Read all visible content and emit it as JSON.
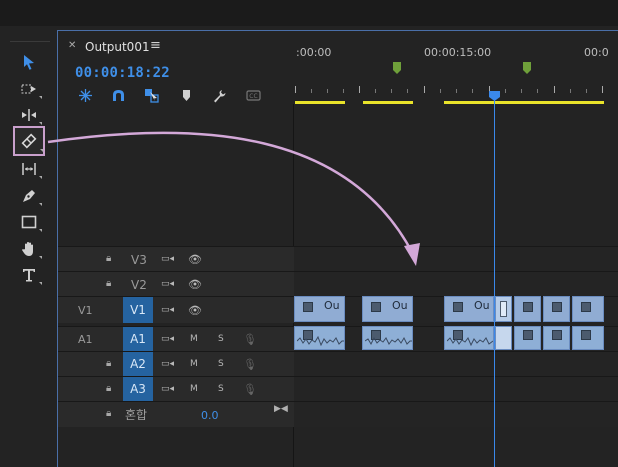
{
  "timeline": {
    "sequence_name": "Output001",
    "timecode": "00:00:18:22",
    "ruler_labels": [
      ":00:00",
      "00:00:15:00",
      "00:0"
    ]
  },
  "tracks": {
    "v3": {
      "name": "V3"
    },
    "v2": {
      "name": "V2"
    },
    "v1": {
      "source": "V1",
      "name": "V1"
    },
    "a1": {
      "source": "A1",
      "name": "A1",
      "mute": "M",
      "solo": "S"
    },
    "a2": {
      "name": "A2",
      "mute": "M",
      "solo": "S"
    },
    "a3": {
      "name": "A3",
      "mute": "M",
      "solo": "S"
    },
    "mix": {
      "name": "혼합",
      "value": "0.0"
    }
  },
  "clips": {
    "label": "Ou"
  },
  "tools": [
    "selection-tool",
    "track-select-tool",
    "ripple-edit-tool",
    "razor-tool",
    "slip-tool",
    "pen-tool",
    "rectangle-tool",
    "hand-tool",
    "type-tool"
  ],
  "colors": {
    "accent": "#3f8fe8",
    "clip": "#90acd3",
    "work_area": "#e9e32a",
    "highlight": "#c9a0cc"
  }
}
